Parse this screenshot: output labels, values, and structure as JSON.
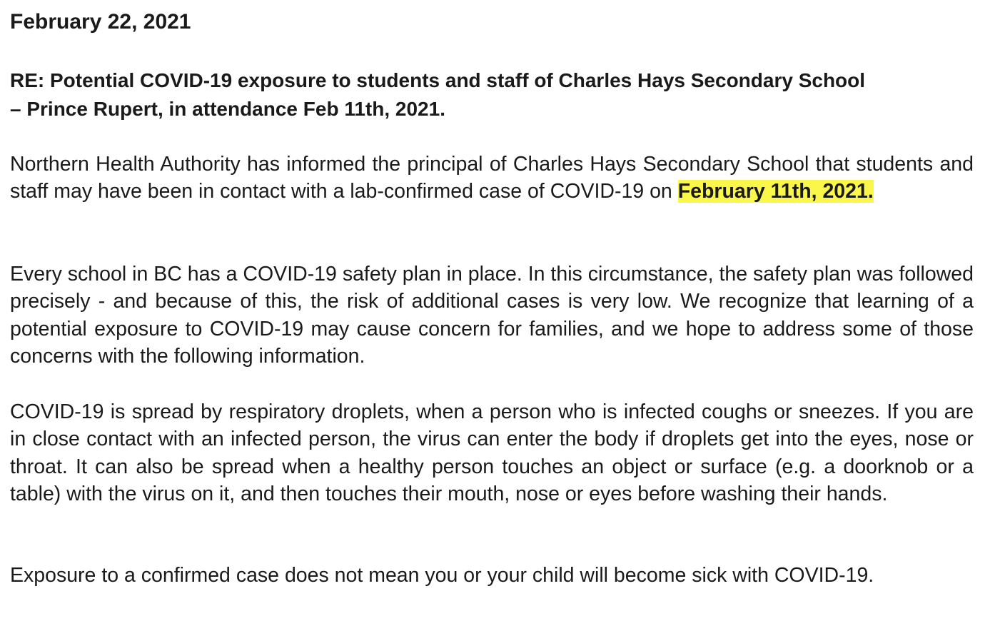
{
  "letter": {
    "date": "February 22, 2021",
    "subject_line1": "RE: Potential COVID-19 exposure to students and staff of Charles Hays Secondary School",
    "subject_line2": "– Prince Rupert, in attendance Feb 11th, 2021.",
    "para1_text": "Northern Health Authority has informed the principal of Charles Hays Secondary School that students and staff may have been in contact with a lab-confirmed case of COVID-19 on ",
    "para1_highlight": "February 11th, 2021.",
    "para2": "Every school in BC has a COVID-19 safety plan in place. In this circumstance, the safety plan was followed precisely - and because of this, the risk of additional cases is very low. We recognize that learning of a potential exposure to COVID-19 may cause concern for families, and we hope to address some of those concerns with the following information.",
    "para3": "COVID-19 is spread by respiratory droplets, when a person who is infected coughs or sneezes. If you are in close contact with an infected person, the virus can enter the body if droplets get into the eyes, nose or throat.  It can also be spread when a healthy person touches an object or surface (e.g. a doorknob or a table) with the virus on it, and then touches their mouth, nose or eyes before washing their hands.",
    "para4": "Exposure to a confirmed case does not mean you or your child will become sick with COVID-19."
  },
  "colors": {
    "highlight": "#fbf74a",
    "text": "#1a1a1a"
  }
}
